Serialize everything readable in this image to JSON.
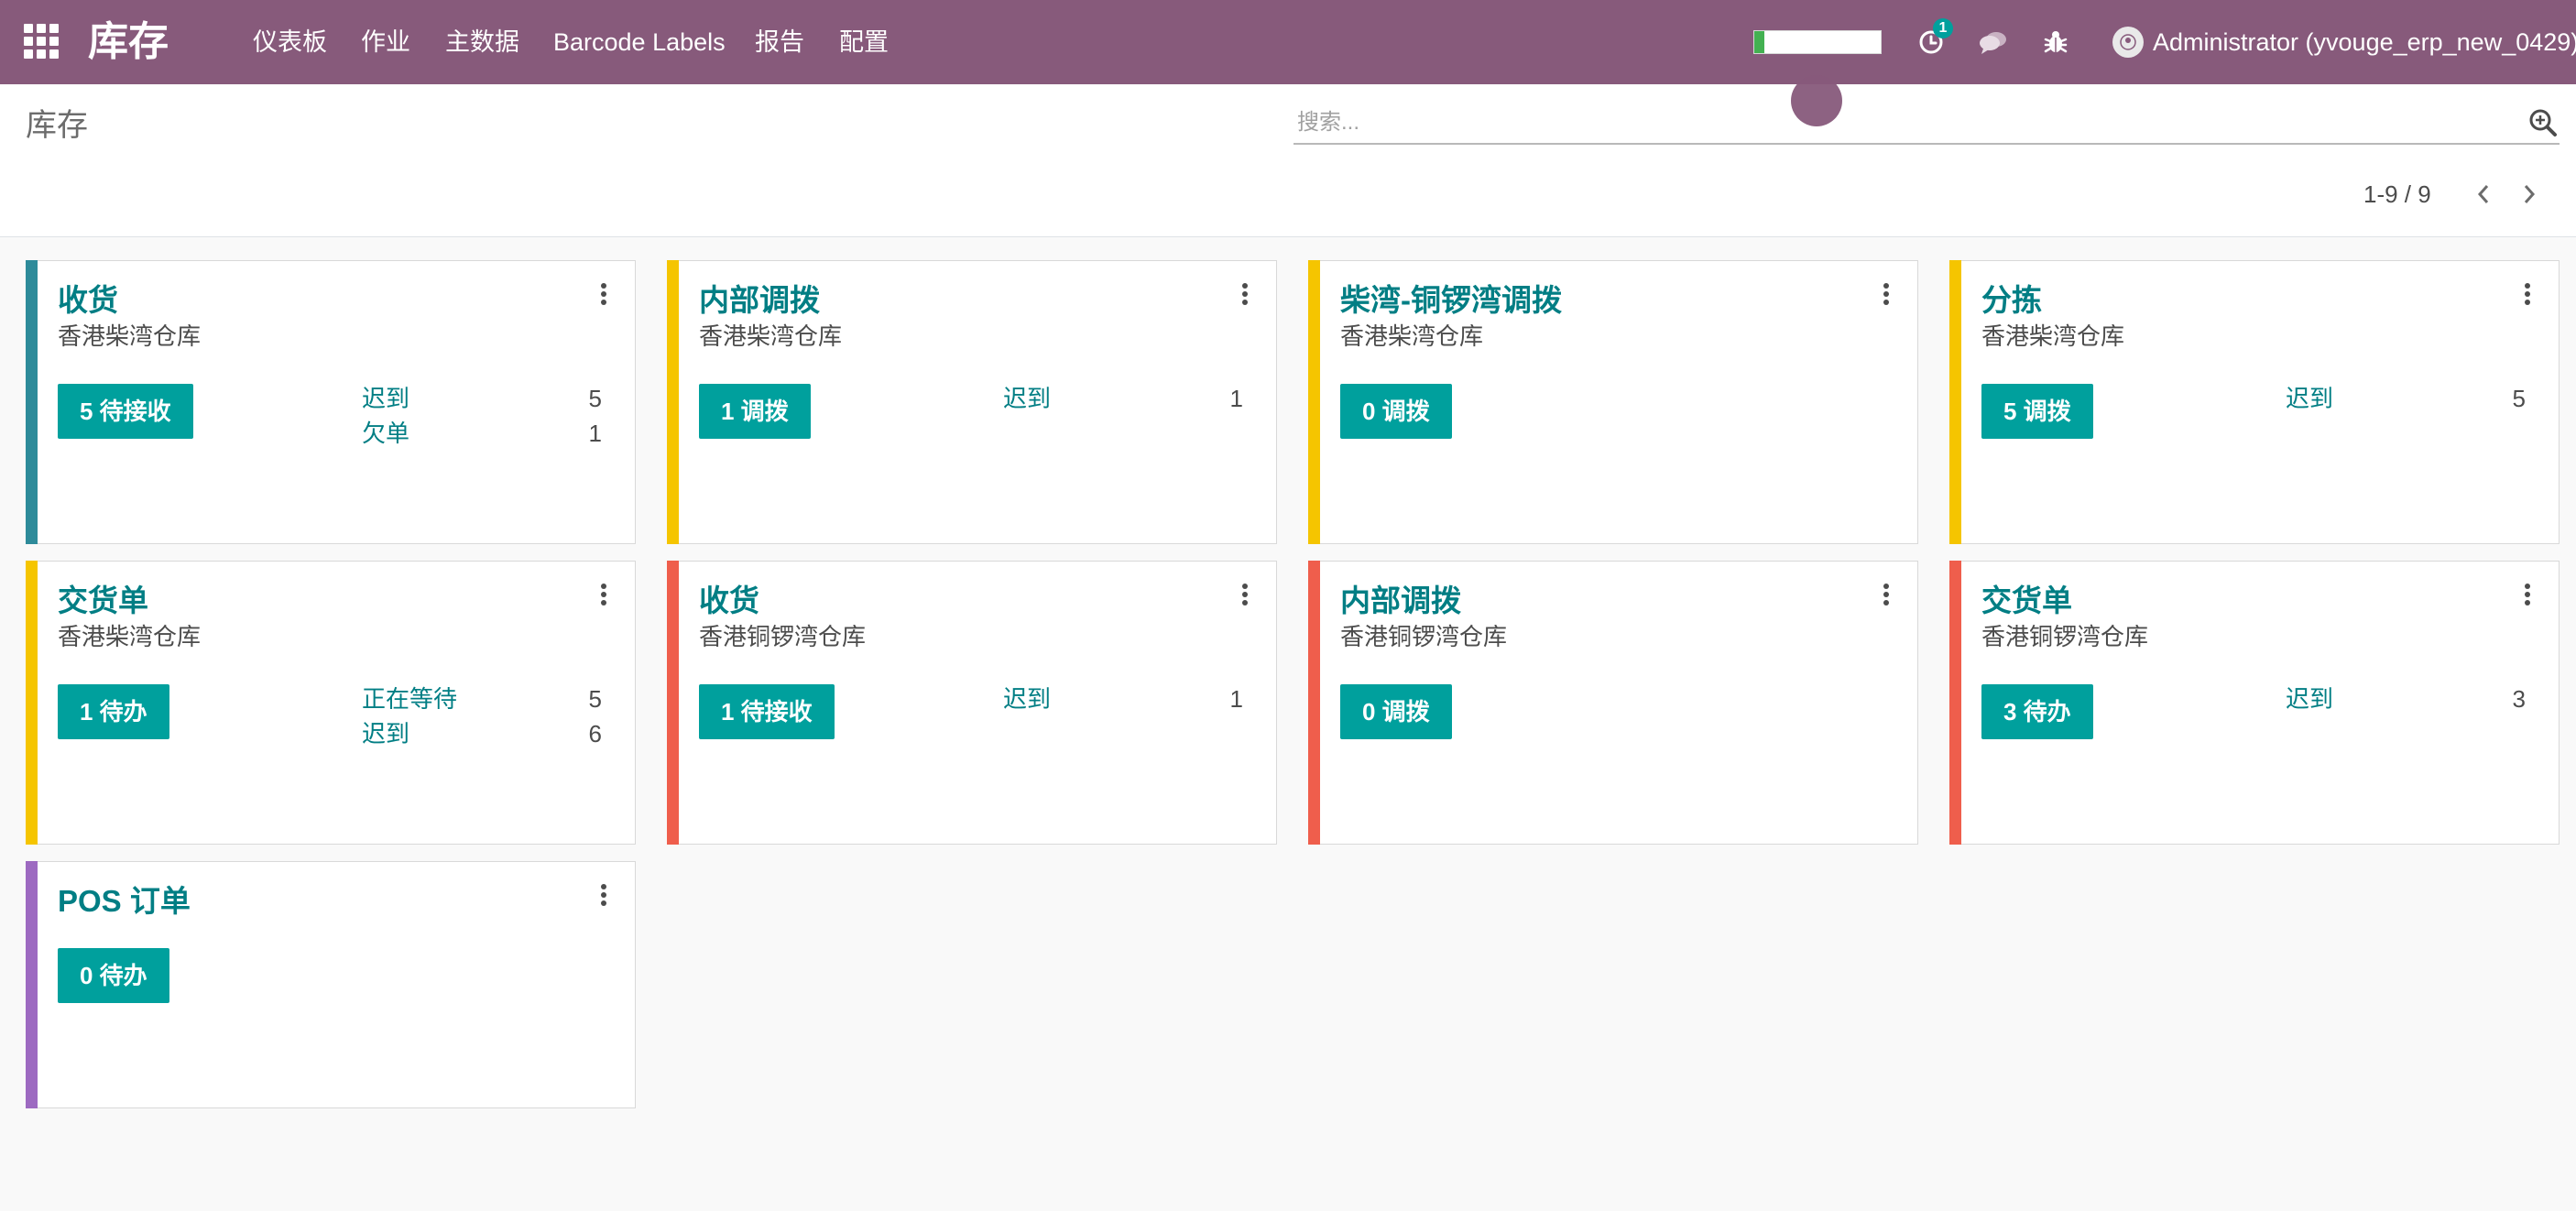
{
  "navbar": {
    "app_title": "库存",
    "menu": [
      "仪表板",
      "作业",
      "主数据",
      "Barcode Labels",
      "报告",
      "配置"
    ],
    "progress": 0.08,
    "activity_badge": "1",
    "user": "Administrator (yvouge_erp_new_0429)",
    "background_color": "#875a7b"
  },
  "control_panel": {
    "breadcrumb": "库存",
    "search_placeholder": "搜索...",
    "pager": "1-9 / 9"
  },
  "colors": {
    "teal": "#00a09d",
    "link": "#017e84",
    "bar_blue": "#2e8b9a",
    "bar_yellow": "#f5c500",
    "bar_red": "#ef5e4c",
    "bar_purple": "#9d6ac1"
  },
  "cards": [
    {
      "title": "收货",
      "subtitle": "香港柴湾仓库",
      "button": "5 待接收",
      "stats": [
        {
          "label": "迟到",
          "count": "5"
        },
        {
          "label": "欠单",
          "count": "1"
        }
      ],
      "color": "#2e8b9a"
    },
    {
      "title": "内部调拨",
      "subtitle": "香港柴湾仓库",
      "button": "1 调拨",
      "stats": [
        {
          "label": "迟到",
          "count": "1"
        }
      ],
      "color": "#f5c500"
    },
    {
      "title": "柴湾-铜锣湾调拨",
      "subtitle": "香港柴湾仓库",
      "button": "0 调拨",
      "stats": [],
      "color": "#f5c500"
    },
    {
      "title": "分拣",
      "subtitle": "香港柴湾仓库",
      "button": "5 调拨",
      "stats": [
        {
          "label": "迟到",
          "count": "5"
        }
      ],
      "color": "#f5c500"
    },
    {
      "title": "交货单",
      "subtitle": "香港柴湾仓库",
      "button": "1 待办",
      "stats": [
        {
          "label": "正在等待",
          "count": "5"
        },
        {
          "label": "迟到",
          "count": "6"
        }
      ],
      "color": "#f5c500"
    },
    {
      "title": "收货",
      "subtitle": "香港铜锣湾仓库",
      "button": "1 待接收",
      "stats": [
        {
          "label": "迟到",
          "count": "1"
        }
      ],
      "color": "#ef5e4c"
    },
    {
      "title": "内部调拨",
      "subtitle": "香港铜锣湾仓库",
      "button": "0 调拨",
      "stats": [],
      "color": "#ef5e4c"
    },
    {
      "title": "交货单",
      "subtitle": "香港铜锣湾仓库",
      "button": "3 待办",
      "stats": [
        {
          "label": "迟到",
          "count": "3"
        }
      ],
      "color": "#ef5e4c"
    },
    {
      "title": "POS 订单",
      "subtitle": "",
      "button": "0 待办",
      "stats": [],
      "color": "#9d6ac1"
    }
  ]
}
